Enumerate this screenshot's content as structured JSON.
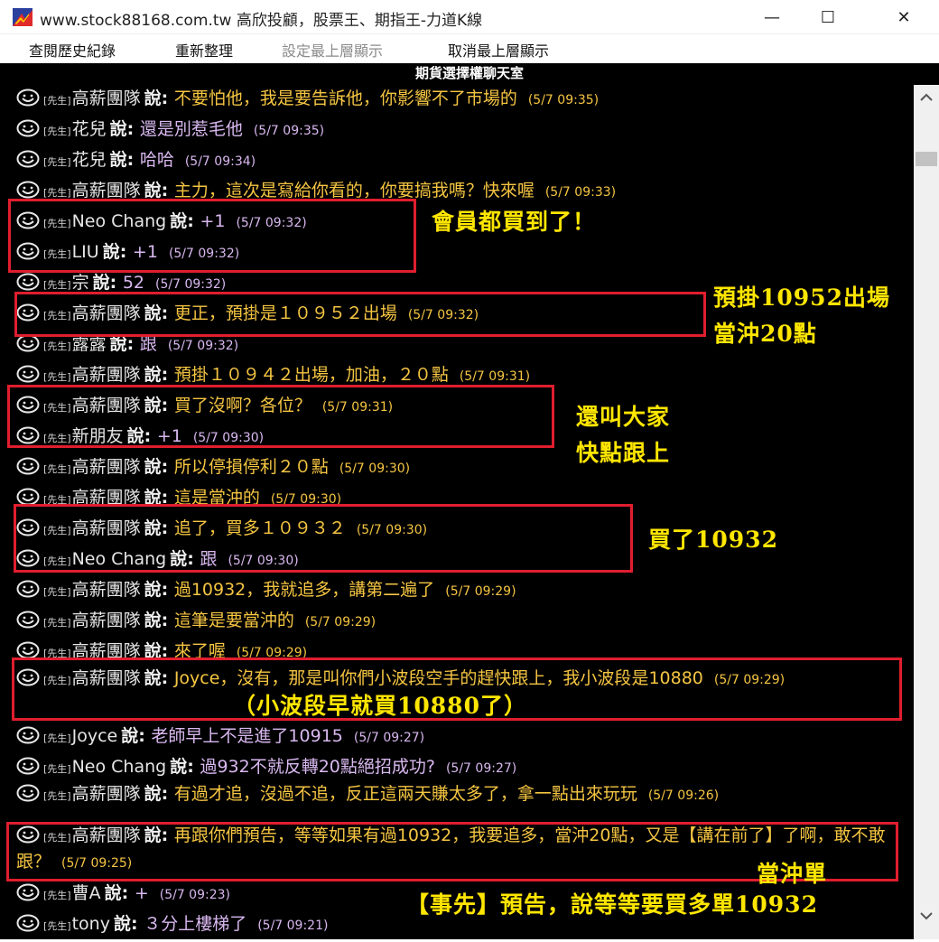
{
  "window": {
    "title": "www.stock88168.com.tw 高欣投顧，股票王、期指王-力道K線",
    "minimize": "—",
    "maximize": "☐",
    "close": "✕"
  },
  "menu": [
    "查閱歷史紀錄",
    "重新整理",
    "設定最上層顯示",
    "取消最上層顯示"
  ],
  "room_title": "期貨選擇權聊天室",
  "say_word": "說:",
  "sender_tag": "[先生]",
  "messages": [
    {
      "name": "高薪團隊",
      "text": "不要怕他，我是要告訴他，你影響不了市場的",
      "time": "(5/7 09:35)",
      "color": "#f5c542"
    },
    {
      "name": "花兒",
      "text": "還是別惹毛他",
      "time": "(5/7 09:35)",
      "color": "#d9b8f0"
    },
    {
      "name": "花兒",
      "text": "哈哈",
      "time": "(5/7 09:34)",
      "color": "#d9b8f0"
    },
    {
      "name": "高薪團隊",
      "text": "主力，這次是寫給你看的，你要搞我嗎？快來喔",
      "time": "(5/7 09:33)",
      "color": "#f5c542"
    },
    {
      "name": "Neo Chang",
      "text": "+1",
      "time": "(5/7 09:32)",
      "color": "#d9b8f0"
    },
    {
      "name": "LIU",
      "text": "+1",
      "time": "(5/7 09:32)",
      "color": "#d9b8f0"
    },
    {
      "name": "宗",
      "text": "52",
      "time": "(5/7 09:32)",
      "color": "#d9b8f0"
    },
    {
      "name": "高薪團隊",
      "text": "更正，預掛是１０９５２出場",
      "time": "(5/7 09:32)",
      "color": "#f5c542"
    },
    {
      "name": "露露",
      "text": "跟",
      "time": "(5/7 09:32)",
      "color": "#d9b8f0"
    },
    {
      "name": "高薪團隊",
      "text": "預掛１０９４２出場，加油，２０點",
      "time": "(5/7 09:31)",
      "color": "#f5c542"
    },
    {
      "name": "高薪團隊",
      "text": "買了沒啊？各位？",
      "time": "(5/7 09:31)",
      "color": "#f5c542"
    },
    {
      "name": "新朋友",
      "text": "+1",
      "time": "(5/7 09:30)",
      "color": "#d9b8f0"
    },
    {
      "name": "高薪團隊",
      "text": "所以停損停利２０點",
      "time": "(5/7 09:30)",
      "color": "#f5c542"
    },
    {
      "name": "高薪團隊",
      "text": "這是當沖的",
      "time": "(5/7 09:30)",
      "color": "#f5c542"
    },
    {
      "name": "高薪團隊",
      "text": "追了，買多１０９３２",
      "time": "(5/7 09:30)",
      "color": "#f5c542"
    },
    {
      "name": "Neo Chang",
      "text": "跟",
      "time": "(5/7 09:30)",
      "color": "#d9b8f0"
    },
    {
      "name": "高薪團隊",
      "text": "過10932，我就追多，講第二遍了",
      "time": "(5/7 09:29)",
      "color": "#f5c542"
    },
    {
      "name": "高薪團隊",
      "text": "這筆是要當沖的",
      "time": "(5/7 09:29)",
      "color": "#f5c542"
    },
    {
      "name": "高薪團隊",
      "text": "來了喔",
      "time": "(5/7 09:29)",
      "color": "#f5c542"
    },
    {
      "name": "高薪團隊",
      "text": "Joyce，沒有，那是叫你們小波段空手的趕快跟上，我小波段是10880",
      "time": "(5/7 09:29)",
      "color": "#f5c542"
    },
    {
      "name": "Joyce",
      "text": "老師早上不是進了10915",
      "time": "(5/7 09:27)",
      "color": "#d9b8f0"
    },
    {
      "name": "Neo Chang",
      "text": "過932不就反轉20點絕招成功?",
      "time": "(5/7 09:27)",
      "color": "#d9b8f0"
    },
    {
      "name": "高薪團隊",
      "text": "有過才追，沒過不追，反正這兩天賺太多了，拿一點出來玩玩",
      "time": "(5/7 09:26)",
      "color": "#f5c542"
    },
    {
      "name": "高薪團隊",
      "text": "再跟你們預告，等等如果有過10932，我要追多，當沖20點，又是【講在前了】了啊，敢不敢跟？",
      "time": "(5/7 09:25)",
      "color": "#f5c542"
    },
    {
      "name": "曹A",
      "text": "+",
      "time": "(5/7 09:23)",
      "color": "#d9b8f0"
    },
    {
      "name": "tony",
      "text": "３分上樓梯了",
      "time": "(5/7 09:21)",
      "color": "#d9b8f0"
    }
  ],
  "annotations": {
    "members_bought": "會員都買到了！",
    "preset_exit": "預掛10952出場",
    "daytrade_20": "當沖20點",
    "call_everyone": "還叫大家",
    "follow_fast": "快點跟上",
    "bought_10932": "買了10932",
    "small_wave": "（小波段早就買10880了）",
    "daytrade_order": "當沖單",
    "pre_notice": "【事先】預告，說等等要買多單10932"
  },
  "colors": {
    "chat_bg": "#000000",
    "box_red": "#e01e2e",
    "annotation_yellow": "#ffe600",
    "text_gold": "#f5c542",
    "text_lavender": "#d9b8f0"
  }
}
